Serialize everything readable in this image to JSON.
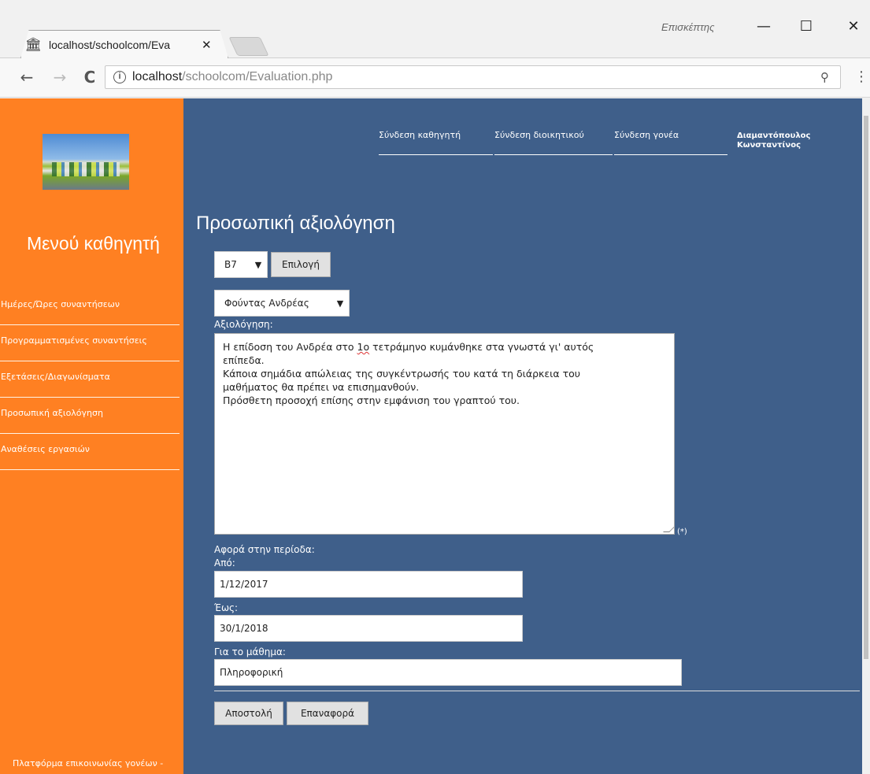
{
  "browser": {
    "tab_title": "localhost/schoolcom/Eva",
    "tab_favicon": "🏛",
    "close_glyph": "✕",
    "profile_label": "Επισκέπτης",
    "window_controls": {
      "minimize": "—",
      "maximize": "☐",
      "close": "✕"
    },
    "nav": {
      "back": "←",
      "forward": "→",
      "reload": "C"
    },
    "info_glyph": "i",
    "url_host": "localhost",
    "url_path": "/schoolcom/Evaluation.php",
    "zoom_glyph": "⚲",
    "menu_glyph": "⋮"
  },
  "sidebar": {
    "logo": "school-building-photo",
    "title": "Μενού καθηγητή",
    "items": [
      {
        "label": "Ημέρες/Ώρες συναντήσεων"
      },
      {
        "label": "Προγραμματισμένες συναντήσεις"
      },
      {
        "label": "Εξετάσεις/Διαγωνίσματα"
      },
      {
        "label": "Προσωπική αξιολόγηση"
      },
      {
        "label": "Αναθέσεις εργασιών"
      }
    ],
    "footer": "Πλατφόρμα επικοινωνίας γονέων -"
  },
  "topnav": {
    "items": [
      {
        "label": "Σύνδεση καθηγητή"
      },
      {
        "label": "Σύνδεση διοικητικού"
      },
      {
        "label": "Σύνδεση γονέα"
      }
    ],
    "user_line1": "Διαμαντόπουλος",
    "user_line2": "Κωνσταντίνος"
  },
  "main": {
    "title": "Προσωπική αξιολόγηση",
    "class_select": {
      "value": "B7",
      "arrow": "▼"
    },
    "select_button": "Επιλογή",
    "student_select": {
      "value": "Φούντας Ανδρέας",
      "arrow": "▼"
    },
    "evaluation_label": "Αξιολόγηση:",
    "evaluation_lines": {
      "l1_a": "Η επίδοση του Ανδρέα στο ",
      "l1_b": "1ο",
      "l1_c": " τετράμηνο κυμάνθηκε στα γνωστά γι' αυτός",
      "l2": "επίπεδα.",
      "l3": "Κάποια σημάδια απώλειας της συγκέντρωσής του κατά τη διάρκεια του",
      "l4": "μαθήματος θα πρέπει να επισημανθούν.",
      "l5": "Πρόσθετη προσοχή επίσης στην εμφάνιση του γραπτού του."
    },
    "required_mark": "(*)",
    "period_label": "Αφορά στην περίοδα:",
    "from_label": "Από:",
    "from_value": "1/12/2017",
    "to_label": "Έως:",
    "to_value": "30/1/2018",
    "subject_label": "Για το μάθημα:",
    "subject_value": "Πληροφορική",
    "submit_button": "Αποστολή",
    "reset_button": "Επαναφορά"
  }
}
